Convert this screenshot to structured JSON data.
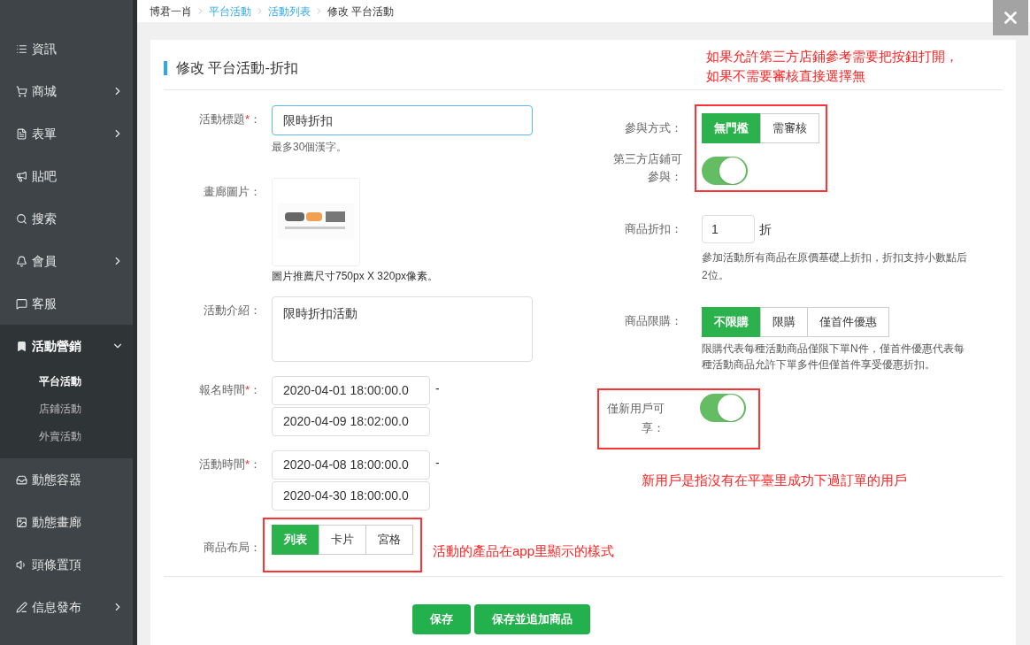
{
  "breadcrumb": [
    {
      "label": "博君一肖",
      "link": false
    },
    {
      "label": "平台活動",
      "link": true
    },
    {
      "label": "活動列表",
      "link": true
    },
    {
      "label": "修改 平台活動",
      "link": false
    }
  ],
  "sidebar": {
    "items": [
      {
        "label": "資訊",
        "expandable": false
      },
      {
        "label": "商城",
        "expandable": true,
        "expanded": false
      },
      {
        "label": "表單",
        "expandable": true,
        "expanded": false
      },
      {
        "label": "貼吧",
        "expandable": false
      },
      {
        "label": "搜索",
        "expandable": false
      },
      {
        "label": "會員",
        "expandable": true,
        "expanded": false
      },
      {
        "label": "客服",
        "expandable": false
      },
      {
        "label": "活動營銷",
        "expandable": true,
        "expanded": true,
        "children": [
          {
            "label": "平台活動",
            "selected": true
          },
          {
            "label": "店鋪活動",
            "selected": false
          },
          {
            "label": "外賣活動",
            "selected": false
          }
        ]
      },
      {
        "label": "動態容器",
        "expandable": false
      },
      {
        "label": "動態畫廊",
        "expandable": false
      },
      {
        "label": "頭條置頂",
        "expandable": false
      },
      {
        "label": "信息發布",
        "expandable": true,
        "expanded": false
      }
    ]
  },
  "form": {
    "title": "修改 平台活動-折扣",
    "top_note": [
      "如果允許第三方店鋪參考需要把按鈕打開，",
      "如果不需要審核直接選擇無"
    ],
    "left": {
      "title_field": {
        "label": "活動標題",
        "mark": "*",
        "suffix": "：",
        "value": "限時折扣",
        "focused": true,
        "hint": "最多30個漢字。"
      },
      "image": {
        "label": "畫廊圖片：",
        "hint": "圖片推薦尺寸750px X 320px像素。"
      },
      "intro": {
        "label": "活動介紹：",
        "value": "限時折扣活動"
      },
      "signup_time": {
        "label": "報名時間",
        "mark": "*",
        "suffix": "：",
        "start": "2020-04-01 18:00:00.0",
        "separator": "-",
        "end": "2020-04-09 18:02:00.0"
      },
      "activity_time": {
        "label": "活動時間",
        "mark": "*",
        "suffix": "：",
        "start": "2020-04-08 18:00:00.0",
        "separator": "-",
        "end": "2020-04-30 18:00:00.0"
      },
      "layout": {
        "label": "商品布局：",
        "options": [
          {
            "label": "列表",
            "selected": true
          },
          {
            "label": "卡片",
            "selected": false
          },
          {
            "label": "宮格",
            "selected": false
          }
        ],
        "note": "活動的產品在app里顯示的樣式"
      }
    },
    "right": {
      "participation": {
        "label": "參與方式：",
        "options": [
          {
            "label": "無門檻",
            "selected": true
          },
          {
            "label": "需審核",
            "selected": false
          }
        ]
      },
      "third_party": {
        "label": "第三方店鋪可參與：",
        "on": true
      },
      "discount": {
        "label": "商品折扣：",
        "value": "1",
        "unit": "折",
        "hint": "參加活動所有商品在原價基礎上折扣，折扣支持小數點后2位。"
      },
      "purchase_limit": {
        "label": "商品限購：",
        "options": [
          {
            "label": "不限購",
            "selected": true
          },
          {
            "label": "限購",
            "selected": false
          },
          {
            "label": "僅首件優惠",
            "selected": false
          }
        ],
        "hint": "限購代表每種活動商品僅限下單N件，僅首件優惠代表每種活動商品允許下單多件但僅首件享受優惠折扣。"
      },
      "new_user_only": {
        "label": "僅新用戶可享：",
        "on": true,
        "note": "新用戶是指沒有在平臺里成功下過訂單的用戶"
      }
    },
    "buttons": [
      "保存",
      "保存並追加商品"
    ]
  }
}
